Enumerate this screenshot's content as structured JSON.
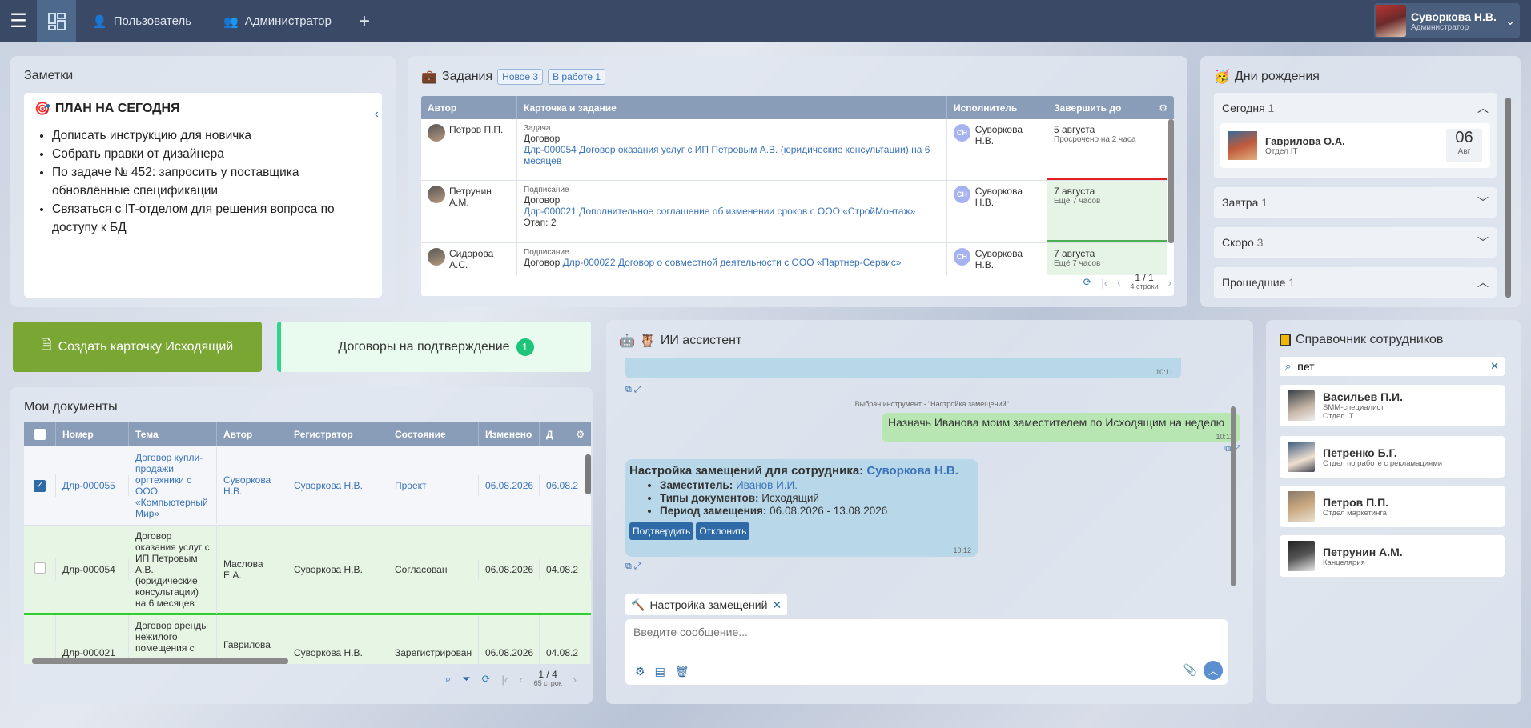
{
  "topbar": {
    "tab_user": "Пользователь",
    "tab_admin": "Администратор",
    "plus": "+",
    "user_name": "Суворкова Н.В.",
    "user_role": "Администратор"
  },
  "notes": {
    "title": "Заметки",
    "heading": "ПЛАН НА СЕГОДНЯ",
    "items": [
      "Дописать инструкцию для новичка",
      "Собрать правки от дизайнера",
      "По задаче № 452: запросить у поставщика обновлённые спецификации",
      "Связаться с IT-отделом для решения вопроса по доступу к БД"
    ]
  },
  "tasks": {
    "title": "Задания",
    "chip_new": "Новое 3",
    "chip_work": "В работе 1",
    "cols": [
      "Автор",
      "Карточка и задание",
      "Исполнитель",
      "Завершить до"
    ],
    "rows": [
      {
        "author": "Петров П.П.",
        "type": "Задача",
        "card": "Договор",
        "link": "Длр-000054 Договор оказания услуг с ИП Петровым А.В. (юридические консультации) на 6 месяцев",
        "stage": "",
        "exec_initials": "СН",
        "exec": "Суворкова Н.В.",
        "due": "5 августа",
        "due_note": "Просрочено на 2 часа"
      },
      {
        "author": "Петрунин А.М.",
        "type": "Подписание",
        "card": "Договор",
        "link": "Длр-000021 Дополнительное соглашение об изменении сроков с ООО «СтройМонтаж»",
        "stage": "Этап: 2",
        "exec_initials": "СН",
        "exec": "Суворкова Н.В.",
        "due": "7 августа",
        "due_note": "Ещё 7 часов"
      },
      {
        "author": "Сидорова А.С.",
        "type": "Подписание",
        "card": "Договор",
        "link": "Длр-000022 Договор о совместной деятельности с ООО «Партнер-Сервис»",
        "stage": "",
        "exec_initials": "СН",
        "exec": "Суворкова Н.В.",
        "due": "7 августа",
        "due_note": "Ещё 7 часов"
      }
    ],
    "pager": "1 / 1",
    "count": "4 строки"
  },
  "birthdays": {
    "title": "Дни рождения",
    "today": "Сегодня",
    "today_n": "1",
    "person": "Гаврилова О.А.",
    "dept": "Отдел IT",
    "day": "06",
    "month": "Авг",
    "tomorrow": "Завтра",
    "tomorrow_n": "1",
    "soon": "Скоро",
    "soon_n": "3",
    "past": "Прошедшие",
    "past_n": "1"
  },
  "actions": {
    "create": "Создать карточку Исходящий",
    "contracts": "Договоры на подтверждение",
    "contracts_n": "1"
  },
  "docs": {
    "title": "Мои документы",
    "cols": [
      "Номер",
      "Тема",
      "Автор",
      "Регистратор",
      "Состояние",
      "Изменено",
      "Д"
    ],
    "rows": [
      {
        "num": "Длр-000055",
        "topic": "Договор купли-продажи оргтехники с ООО «Компьютерный Мир»",
        "author": "Суворкова Н.В.",
        "reg": "Суворкова Н.В.",
        "state": "Проект",
        "changed": "06.08.2026",
        "d": "06.08.2"
      },
      {
        "num": "Длр-000054",
        "topic": "Договор оказания услуг с ИП Петровым А.В. (юридические консультации) на 6 месяцев",
        "author": "Маслова Е.А.",
        "reg": "Суворкова Н.В.",
        "state": "Согласован",
        "changed": "06.08.2026",
        "d": "04.08.2"
      },
      {
        "num": "Длр-000021",
        "topic": "Договор аренды нежилого помещения с",
        "author": "Гаврилова",
        "reg": "Суворкова Н.В.",
        "state": "Зарегистрирован",
        "changed": "06.08.2026",
        "d": "04.08.2"
      }
    ],
    "pager": "1 / 4",
    "count": "65 строк"
  },
  "ai": {
    "title": "ИИ ассистент",
    "time1": "10:11",
    "system": "Выбран инструмент - \"Настройка замещений\".",
    "user_msg": "Назначь Иванова моим заместителем по Исходящим на неделю",
    "time2": "10:12",
    "card_title": "Настройка замещений для сотрудника:",
    "card_name": "Суворкова Н.В.",
    "l_deputy": "Заместитель:",
    "v_deputy": "Иванов И.И.",
    "l_types": "Типы документов:",
    "v_types": "Исходящий",
    "l_period": "Период замещения:",
    "v_period": "06.08.2026 - 13.08.2026",
    "btn_ok": "Подтвердить",
    "btn_no": "Отклонить",
    "time3": "10:12",
    "tool_chip": "Настройка замещений",
    "placeholder": "Введите сообщение..."
  },
  "directory": {
    "title": "Справочник сотрудников",
    "search": "пет",
    "people": [
      {
        "name": "Васильев П.И.",
        "role": "SMM-специалист",
        "dept": "Отдел IT"
      },
      {
        "name": "Петренко Б.Г.",
        "role": "Отдел по работе с рекламациями",
        "dept": ""
      },
      {
        "name": "Петров П.П.",
        "role": "Отдел маркетинга",
        "dept": ""
      },
      {
        "name": "Петрунин А.М.",
        "role": "Канцелярия",
        "dept": ""
      }
    ]
  }
}
